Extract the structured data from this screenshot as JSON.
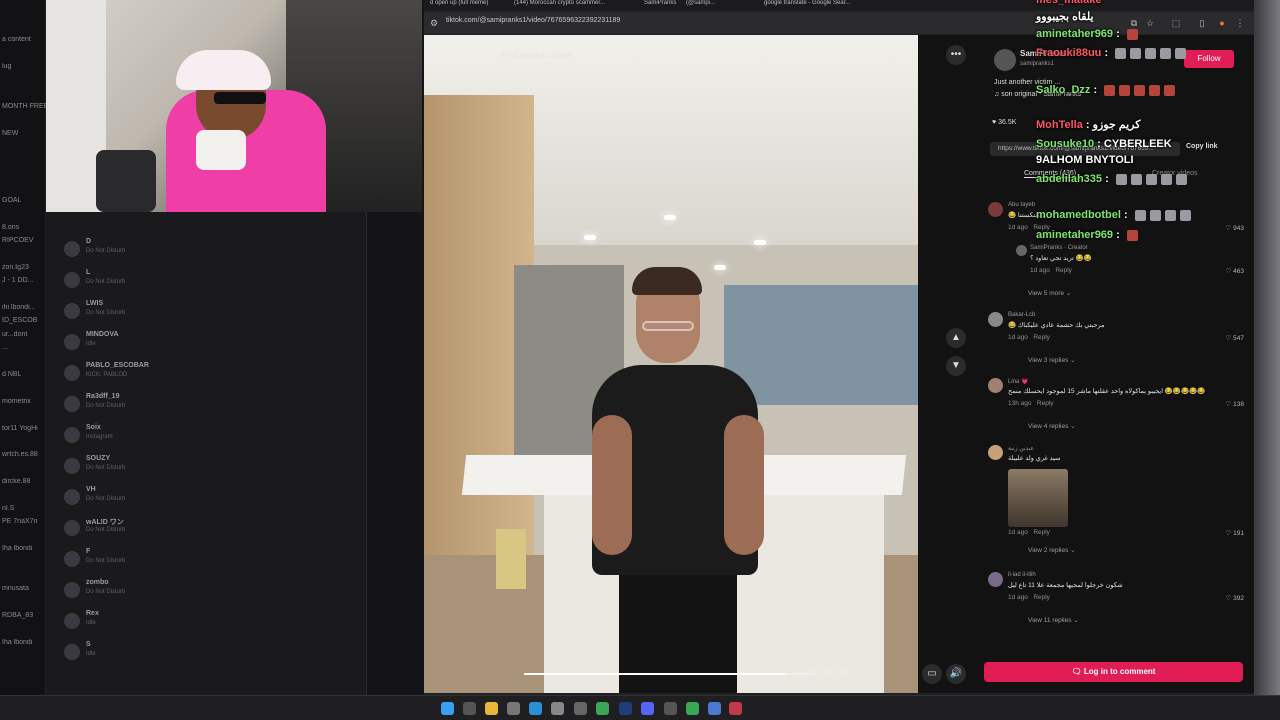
{
  "browser": {
    "tabs": [
      "d open up (full meme)",
      "(144) Moroccan crypto scammer...",
      "SamiPranks",
      "(@sampi...",
      "google translate - Google Sear..."
    ],
    "url": "tiktok.com/@samipranks1/video/7676596322392231189"
  },
  "video": {
    "overlay_text": "Find related content",
    "timecode": "01:16/01:25",
    "progress": 0.9
  },
  "post": {
    "creator": "SamiPranks",
    "handle": "samipranks1",
    "caption": "Just another victim ...",
    "sound": "♫ son original - SamiPranks",
    "follow_label": "Follow",
    "like_count": "36.5K",
    "link_text": "https://www.tiktok.com/@samipranks1/video/767659...",
    "copy_link_label": "Copy link",
    "comments_tab": "Comments (436)",
    "creator_videos_tab": "Creator videos"
  },
  "comments": [
    {
      "name": "Abu tayeb",
      "text": "😂 منكستنا...",
      "meta": "1d ago",
      "reply": "Reply",
      "likes": "943"
    },
    {
      "name": "SamiPranks · Creator",
      "text": "تزيد تجي تعاود ؟ 😂😂",
      "meta": "1d ago",
      "reply": "Reply",
      "likes": "463",
      "more": "View 5 more"
    },
    {
      "name": "Bakar-Lcb",
      "text": "😂 مرحبتي بك حشمة عادي عليكباك",
      "meta": "1d ago",
      "reply": "Reply",
      "likes": "547",
      "more": "View 3 replies"
    },
    {
      "name": "Lina 💗",
      "text": "ايجيبو يماكولاه واحد عقلتها ماشر 15 لموجود ايحسلك منمح 😂😂😂😂😂",
      "meta": "13h ago",
      "reply": "Reply",
      "likes": "138",
      "more": "View 4 replies"
    },
    {
      "name": "عبدبن زنبة",
      "text": "سيد غري ولد علبيلة",
      "meta": "1d ago",
      "reply": "Reply",
      "likes": "191",
      "more": "View 2 replies"
    },
    {
      "name": "il-lad il-illih",
      "text": "شكون خرجلوا لمجيها مجمعة علا 11 تاع ليل",
      "meta": "1d ago",
      "reply": "Reply",
      "likes": "392",
      "more": "View 11 replies"
    }
  ],
  "login_comment": "Log in to comment",
  "chat": [
    {
      "user": "mes_malake",
      "msg": ""
    },
    {
      "user": "",
      "msg": "يلقاه بجيبووو"
    },
    {
      "user": "aminetaher969",
      "msg": ""
    },
    {
      "user": "Fraouki88uu",
      "msg": ""
    },
    {
      "user": "Salko_Dzz",
      "msg": ""
    },
    {
      "user": "MohTella",
      "msg": "كريم جوزو"
    },
    {
      "user": "Sousuke10",
      "msg": "CYBERLEEK"
    },
    {
      "user": "",
      "msg": "9ALHOM BNYTOLI"
    },
    {
      "user": "abdelilah335",
      "msg": ""
    },
    {
      "user": "mohamedbotbel",
      "msg": ""
    },
    {
      "user": "aminetaher969",
      "msg": ""
    }
  ],
  "discord_members": [
    {
      "name": "D",
      "status": "Do Not Disturb"
    },
    {
      "name": "L",
      "status": "Do Not Disturb"
    },
    {
      "name": "LWIS",
      "status": "Do Not Disturb"
    },
    {
      "name": "MINDOVA",
      "status": "Idle"
    },
    {
      "name": "PABLO_ESCOBAR",
      "status": "KICK: PABLOD"
    },
    {
      "name": "Ra3dff_19",
      "status": "Do Not Disturb"
    },
    {
      "name": "Soix",
      "status": "Instagram"
    },
    {
      "name": "SOUZY",
      "status": "Do Not Disturb"
    },
    {
      "name": "VH",
      "status": "Do Not Disturb"
    },
    {
      "name": "wALID ワン",
      "status": "Do Not Disturb"
    },
    {
      "name": "F",
      "status": "Do Not Disturb"
    },
    {
      "name": "zombo",
      "status": "Do Not Disturb"
    },
    {
      "name": "Rex",
      "status": "Idle"
    },
    {
      "name": "S",
      "status": "Idle"
    }
  ],
  "discord_channels": [
    "a content",
    "",
    "lug",
    "",
    "",
    "MONTH FREE",
    "",
    "NEW",
    "",
    "",
    "",
    "",
    "GOAL",
    "",
    "8.ons",
    "RIPCOEV",
    "",
    "zon.tg23",
    "J - 1 DD...",
    "",
    "ihi lbondi...",
    "ID_ESCOB",
    "ur...dont",
    "...",
    "",
    "d NBL",
    "",
    "mometrix",
    "",
    "tor11 YogHi",
    "",
    "wrtch.es.88",
    "",
    "dircke.88",
    "",
    "nI.S",
    "PE 7naX7n",
    "",
    "Iha lbondi",
    "",
    "",
    "mnusata",
    "",
    "RDBA_83",
    "",
    "Iha lbondi"
  ],
  "colors": {
    "tiktok_red": "#e11d55",
    "chat_user_green": "#7ee56d"
  }
}
